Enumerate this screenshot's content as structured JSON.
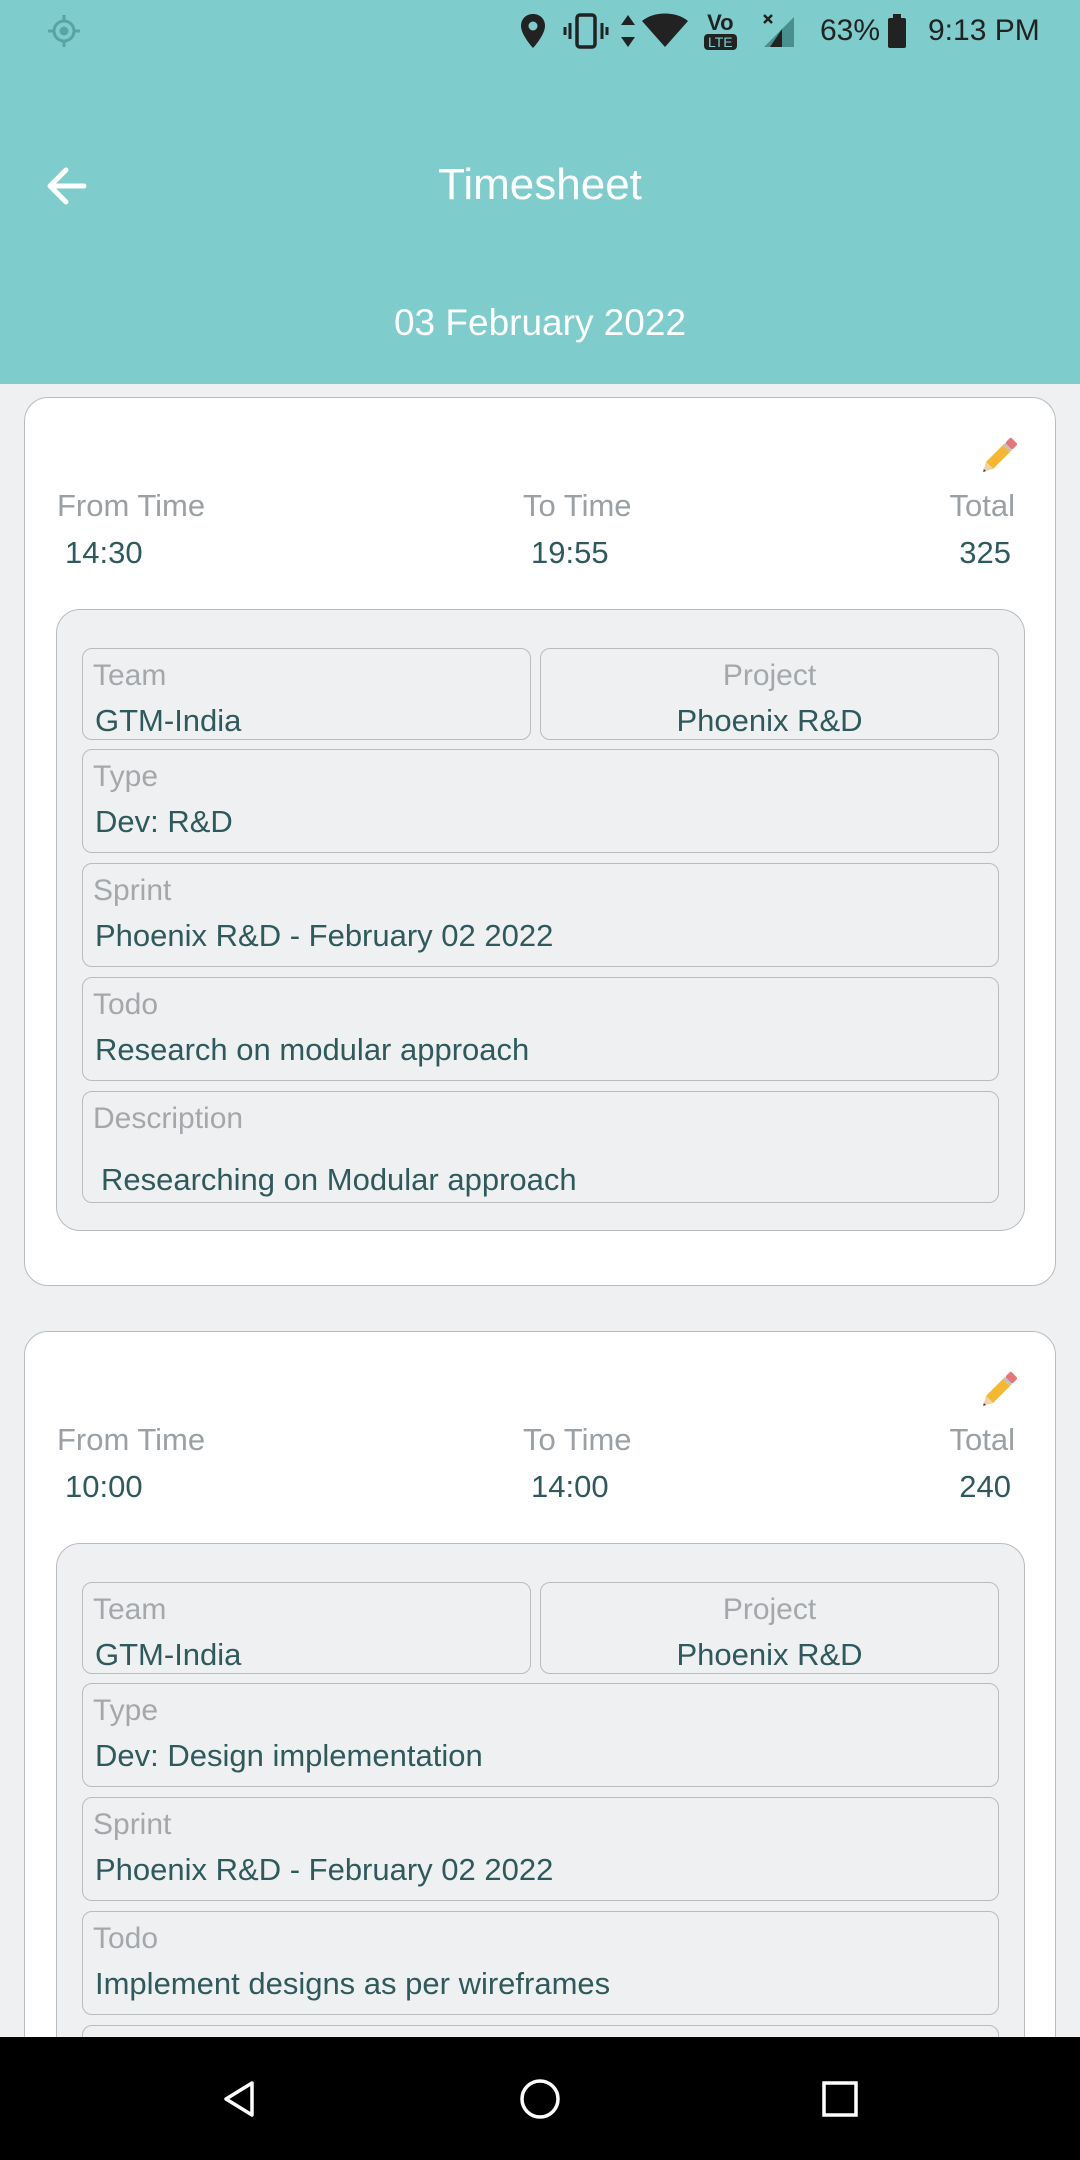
{
  "status_bar": {
    "battery_percent": "63%",
    "time": "9:13 PM",
    "network_badge_top": "Vo",
    "network_badge_bottom": "LTE",
    "icons": [
      "location-service-icon",
      "location-pin-icon",
      "vibrate-icon",
      "data-arrows-icon",
      "wifi-icon",
      "volte-icon",
      "signal-icon",
      "battery-icon"
    ]
  },
  "app_bar": {
    "title": "Timesheet",
    "date": "03 February 2022"
  },
  "labels": {
    "from_time": "From Time",
    "to_time": "To Time",
    "total": "Total",
    "team": "Team",
    "project": "Project",
    "type": "Type",
    "sprint": "Sprint",
    "todo": "Todo",
    "description": "Description"
  },
  "entries": [
    {
      "from_time": "14:30",
      "to_time": "19:55",
      "total": "325",
      "team": "GTM-India",
      "project": "Phoenix R&D",
      "type": "Dev: R&D",
      "sprint": "Phoenix R&D - February 02 2022",
      "todo": "Research on modular approach",
      "description": "Researching on Modular approach"
    },
    {
      "from_time": "10:00",
      "to_time": "14:00",
      "total": "240",
      "team": "GTM-India",
      "project": "Phoenix R&D",
      "type": "Dev: Design implementation",
      "sprint": "Phoenix R&D - February 02 2022",
      "todo": "Implement designs as per wireframes"
    }
  ],
  "colors": {
    "header": "#7ecccc",
    "background": "#eff0f2",
    "value_text": "#2f5a5c",
    "label_text": "#9aa0a3"
  }
}
